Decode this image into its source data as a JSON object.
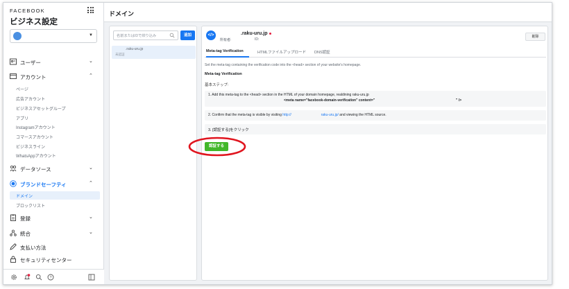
{
  "brand": "FACEBOOK",
  "sidebar": {
    "title": "ビジネス設定",
    "nav": [
      {
        "label": "ユーザー",
        "icon": "user-card-icon",
        "expanded": false
      },
      {
        "label": "アカウント",
        "icon": "folder-icon",
        "expanded": true
      },
      {
        "label": "データソース",
        "icon": "data-sources-icon",
        "expanded": false
      },
      {
        "label": "ブランドセーフティ",
        "icon": "shield-icon",
        "expanded": true
      },
      {
        "label": "登録",
        "icon": "clipboard-icon",
        "expanded": false
      },
      {
        "label": "統合",
        "icon": "integrations-icon",
        "expanded": false
      },
      {
        "label": "支払い方法",
        "icon": "pencil-icon",
        "expanded": false
      },
      {
        "label": "セキュリティセンター",
        "icon": "lock-icon",
        "expanded": false
      }
    ],
    "account_items": [
      "ページ",
      "広告アカウント",
      "ビジネスアセットグループ",
      "アプリ",
      "Instagramアカウント",
      "コマースアカウント",
      "ビジネスライン",
      "WhatsAppアカウント"
    ],
    "brand_safety_items": [
      "ドメイン",
      "ブロックリスト"
    ],
    "active_item": "ドメイン"
  },
  "header": {
    "title": "ドメイン"
  },
  "list": {
    "search_placeholder": "名前またはIDで絞り込み",
    "add_label": "追加",
    "items": [
      {
        "name": ".raku-uru.jp",
        "status": "未認証"
      }
    ]
  },
  "detail": {
    "domain": ".raku-uru.jp",
    "owner_label": "所有者:",
    "id_label": "ID:",
    "delete_label": "削除",
    "tabs": [
      "Meta-tag Verification",
      "HTMLファイルアップロード",
      "DNS認証"
    ],
    "active_tab": "Meta-tag Verification",
    "intro": "Set the meta-tag containing the verification code into the <head> section of your website's homepage.",
    "section_title": "Meta-tag Verification",
    "steps_label": "基本ステップ:",
    "step1_text": "1. Add this meta-tag to the <head> section in the HTML of your domain homepage, realdining raku-uru.jp",
    "step1_code": "<meta name=\"facebook-domain-verification\" content=\"",
    "step1_code_end": "\" />",
    "step2_prefix": "2. Confirm that the meta-tag is visible by visiting",
    "step2_link1": "http://",
    "step2_link2": "raku-uru.jp/",
    "step2_suffix": "and viewing the HTML source.",
    "step3_text": "3. [認証する]をクリック",
    "verify_label": "認証する"
  },
  "colors": {
    "accent": "#1877f2",
    "verify": "#42b72a",
    "annotation": "#e0141e"
  }
}
